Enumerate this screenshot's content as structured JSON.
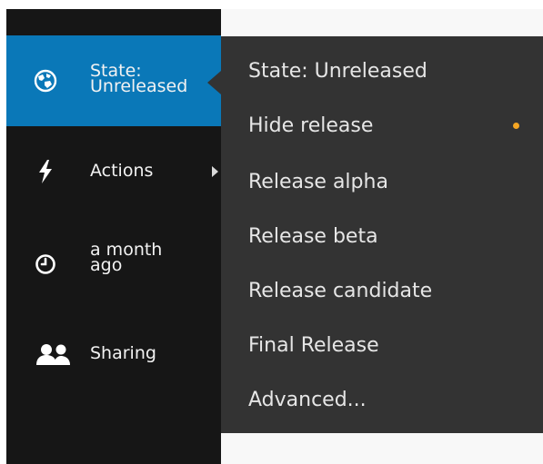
{
  "sidebar": {
    "items": [
      {
        "icon": "globe-icon",
        "label": "State:\nUnreleased",
        "active": true
      },
      {
        "icon": "bolt-icon",
        "label": "Actions",
        "has_submenu": true
      },
      {
        "icon": "clock-icon",
        "label": "a month\nago"
      },
      {
        "icon": "users-icon",
        "label": "Sharing"
      }
    ]
  },
  "state_menu": {
    "items": [
      {
        "label": "State: Unreleased"
      },
      {
        "label": "Hide release",
        "indicator": true
      },
      {
        "label": "Release alpha"
      },
      {
        "label": "Release beta"
      },
      {
        "label": "Release candidate"
      },
      {
        "label": "Final Release"
      },
      {
        "label": "Advanced..."
      }
    ]
  },
  "colors": {
    "sidebar_bg": "#161616",
    "active_bg": "#0a78b8",
    "menu_bg": "#333333",
    "indicator": "#f5a623"
  }
}
